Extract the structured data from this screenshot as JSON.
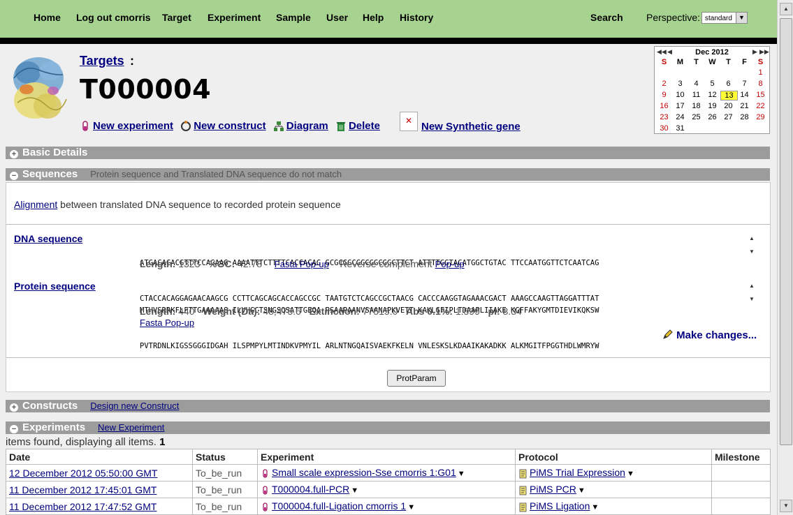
{
  "nav": {
    "items": [
      "Home",
      "Log out cmorris",
      "Target",
      "Experiment",
      "Sample",
      "User",
      "Help",
      "History"
    ],
    "search": "Search",
    "perspective_label": "Perspective:",
    "perspective_value": "standard"
  },
  "header": {
    "breadcrumb_link": "Targets",
    "breadcrumb_sep": ":",
    "title": "T000004",
    "actions": [
      "New experiment",
      "New construct",
      "Diagram",
      "Delete"
    ],
    "synthetic_gene": "New Synthetic gene"
  },
  "calendar": {
    "month": "Dec 2012",
    "weekdays": [
      "S",
      "M",
      "T",
      "W",
      "T",
      "F",
      "S"
    ],
    "today": "13",
    "weeks": [
      [
        "",
        "",
        "",
        "",
        "",
        "",
        "1"
      ],
      [
        "2",
        "3",
        "4",
        "5",
        "6",
        "7",
        "8"
      ],
      [
        "9",
        "10",
        "11",
        "12",
        "13",
        "14",
        "15"
      ],
      [
        "16",
        "17",
        "18",
        "19",
        "20",
        "21",
        "22"
      ],
      [
        "23",
        "24",
        "25",
        "26",
        "27",
        "28",
        "29"
      ],
      [
        "30",
        "31",
        "",
        "",
        "",
        "",
        ""
      ]
    ]
  },
  "sections": {
    "basic": "Basic Details",
    "sequences": "Sequences",
    "sequences_note": "Protein sequence and Translated DNA sequence do not match",
    "constructs": "Constructs",
    "constructs_link": "Design new Construct",
    "experiments": "Experiments",
    "experiments_link": "New Experiment"
  },
  "sequences": {
    "alignment_link": "Alignment",
    "alignment_text": "between translated DNA sequence to recorded protein sequence",
    "dna_label": "DNA sequence",
    "dna_line1": "ATGACACACGTTTCCAGAAG AAAATTTCTTTTCACCACAG GCGCGGCGGCGGCGGCTTCT ATTTTGGTACATGGCTGTAC TTCCAATGGTTCTCAATCAG",
    "dna_line2": "CTACCACAGGAGAACAAGCG CCTTCAGCAGCACCAGCCGC TAATGTCTCAGCCGCTAACG CACCCAAGGTAGAAACGACT AAAGCCAAGTTAGGATTTAT",
    "dna_length_label": "Length:",
    "dna_length": "1323",
    "gc_label": "%GC:",
    "gc": "42.78",
    "dna_fasta": "Fasta Pop-up",
    "revcomp_label": "Reverse complement",
    "revcomp_link": "Pop-up",
    "protein_label": "Protein sequence",
    "prot_line1": "MTHVSRRKFLFTTGAAAAAS ILVHGCTSNGSQSATTGEQA PSAAPAANVSAANAPKVETT KAKLGFIPLTDAAPLIIAKE KGFFAKYGMTDIEVIKQKSW",
    "prot_line2": "PVTRDNLKIGSSGGGIDGAH ILSPMPYLMTINDKVPMYIL ARLNTNGQAISVAEKFKELN VNLESKSLKDAAIKAKADKK ALKMGITFPGGTHDLWMRYW",
    "prot_length_label": "Length:",
    "prot_length": "440",
    "weight_label": "Weight (Da):",
    "weight": "48,475.6",
    "extinction_label": "Extinction:",
    "extinction": "77515.0",
    "abs_label": "Abs 0.1%:",
    "abs": "1.599",
    "pi_label": "pI:",
    "pi": "8.34",
    "prot_fasta": "Fasta Pop-up",
    "make_changes": "Make changes...",
    "protparam": "ProtParam"
  },
  "experiments": {
    "items_found": "items found, displaying all items.",
    "count": "1",
    "columns": [
      "Date",
      "Status",
      "Experiment",
      "Protocol",
      "Milestone"
    ],
    "rows": [
      {
        "date": "12 December 2012 05:50:00 GMT",
        "status": "To_be_run",
        "experiment": "Small scale expression-Sse cmorris 1:G01",
        "protocol": "PiMS Trial Expression",
        "milestone": ""
      },
      {
        "date": "11 December 2012 17:45:01 GMT",
        "status": "To_be_run",
        "experiment": "T000004.full-PCR",
        "protocol": "PiMS PCR",
        "milestone": ""
      },
      {
        "date": "11 December 2012 17:47:52 GMT",
        "status": "To_be_run",
        "experiment": "T000004.full-Ligation cmorris 1",
        "protocol": "PiMS Ligation",
        "milestone": ""
      }
    ]
  },
  "icons": [
    "protein-structure-image",
    "new-experiment-icon",
    "new-construct-icon",
    "diagram-icon",
    "delete-icon",
    "broken-image-icon",
    "pencil-icon",
    "experiment-icon",
    "protocol-icon"
  ],
  "colors": {
    "nav_bg": "#a7d391",
    "section_bar": "#9c9c9c",
    "link": "#000080",
    "today": "#ffff33",
    "weekend": "#c00000"
  }
}
